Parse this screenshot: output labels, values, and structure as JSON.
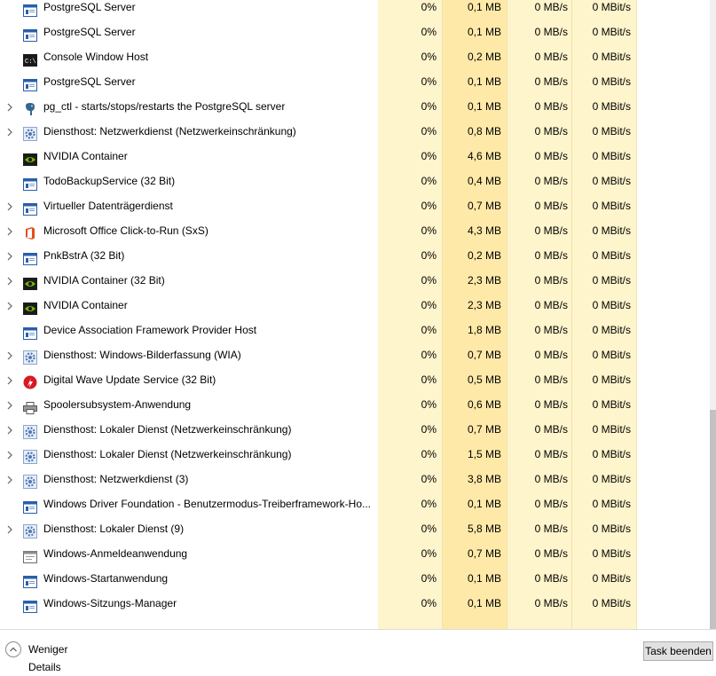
{
  "processes": [
    {
      "name": "PostgreSQL Server",
      "icon": "service-window-icon",
      "expandable": false,
      "cpu": "0%",
      "mem": "0,1 MB",
      "disk": "0 MB/s",
      "net": "0 MBit/s"
    },
    {
      "name": "PostgreSQL Server",
      "icon": "service-window-icon",
      "expandable": false,
      "cpu": "0%",
      "mem": "0,1 MB",
      "disk": "0 MB/s",
      "net": "0 MBit/s"
    },
    {
      "name": "Console Window Host",
      "icon": "console-icon",
      "expandable": false,
      "cpu": "0%",
      "mem": "0,2 MB",
      "disk": "0 MB/s",
      "net": "0 MBit/s"
    },
    {
      "name": "PostgreSQL Server",
      "icon": "service-window-icon",
      "expandable": false,
      "cpu": "0%",
      "mem": "0,1 MB",
      "disk": "0 MB/s",
      "net": "0 MBit/s"
    },
    {
      "name": "pg_ctl - starts/stops/restarts the PostgreSQL server",
      "icon": "postgres-elephant-icon",
      "expandable": true,
      "cpu": "0%",
      "mem": "0,1 MB",
      "disk": "0 MB/s",
      "net": "0 MBit/s"
    },
    {
      "name": "Diensthost: Netzwerkdienst (Netzwerkeinschränkung)",
      "icon": "gear-icon",
      "expandable": true,
      "cpu": "0%",
      "mem": "0,8 MB",
      "disk": "0 MB/s",
      "net": "0 MBit/s"
    },
    {
      "name": "NVIDIA Container",
      "icon": "nvidia-icon",
      "expandable": false,
      "cpu": "0%",
      "mem": "4,6 MB",
      "disk": "0 MB/s",
      "net": "0 MBit/s"
    },
    {
      "name": "TodoBackupService (32 Bit)",
      "icon": "service-window-icon",
      "expandable": false,
      "cpu": "0%",
      "mem": "0,4 MB",
      "disk": "0 MB/s",
      "net": "0 MBit/s"
    },
    {
      "name": "Virtueller Datenträgerdienst",
      "icon": "service-window-icon",
      "expandable": true,
      "cpu": "0%",
      "mem": "0,7 MB",
      "disk": "0 MB/s",
      "net": "0 MBit/s"
    },
    {
      "name": "Microsoft Office Click-to-Run (SxS)",
      "icon": "office-icon",
      "expandable": true,
      "cpu": "0%",
      "mem": "4,3 MB",
      "disk": "0 MB/s",
      "net": "0 MBit/s"
    },
    {
      "name": "PnkBstrA (32 Bit)",
      "icon": "service-window-icon",
      "expandable": true,
      "cpu": "0%",
      "mem": "0,2 MB",
      "disk": "0 MB/s",
      "net": "0 MBit/s"
    },
    {
      "name": "NVIDIA Container (32 Bit)",
      "icon": "nvidia-icon",
      "expandable": true,
      "cpu": "0%",
      "mem": "2,3 MB",
      "disk": "0 MB/s",
      "net": "0 MBit/s"
    },
    {
      "name": "NVIDIA Container",
      "icon": "nvidia-icon",
      "expandable": true,
      "cpu": "0%",
      "mem": "2,3 MB",
      "disk": "0 MB/s",
      "net": "0 MBit/s"
    },
    {
      "name": "Device Association Framework Provider Host",
      "icon": "service-window-icon",
      "expandable": false,
      "cpu": "0%",
      "mem": "1,8 MB",
      "disk": "0 MB/s",
      "net": "0 MBit/s"
    },
    {
      "name": "Diensthost: Windows-Bilderfassung (WIA)",
      "icon": "gear-icon",
      "expandable": true,
      "cpu": "0%",
      "mem": "0,7 MB",
      "disk": "0 MB/s",
      "net": "0 MBit/s"
    },
    {
      "name": "Digital Wave Update Service (32 Bit)",
      "icon": "digital-wave-icon",
      "expandable": true,
      "cpu": "0%",
      "mem": "0,5 MB",
      "disk": "0 MB/s",
      "net": "0 MBit/s"
    },
    {
      "name": "Spoolersubsystem-Anwendung",
      "icon": "printer-icon",
      "expandable": true,
      "cpu": "0%",
      "mem": "0,6 MB",
      "disk": "0 MB/s",
      "net": "0 MBit/s"
    },
    {
      "name": "Diensthost: Lokaler Dienst (Netzwerkeinschränkung)",
      "icon": "gear-icon",
      "expandable": true,
      "cpu": "0%",
      "mem": "0,7 MB",
      "disk": "0 MB/s",
      "net": "0 MBit/s"
    },
    {
      "name": "Diensthost: Lokaler Dienst (Netzwerkeinschränkung)",
      "icon": "gear-icon",
      "expandable": true,
      "cpu": "0%",
      "mem": "1,5 MB",
      "disk": "0 MB/s",
      "net": "0 MBit/s"
    },
    {
      "name": "Diensthost: Netzwerkdienst (3)",
      "icon": "gear-icon",
      "expandable": true,
      "cpu": "0%",
      "mem": "3,8 MB",
      "disk": "0 MB/s",
      "net": "0 MBit/s"
    },
    {
      "name": "Windows Driver Foundation - Benutzermodus-Treiberframework-Ho...",
      "icon": "service-window-icon",
      "expandable": false,
      "cpu": "0%",
      "mem": "0,1 MB",
      "disk": "0 MB/s",
      "net": "0 MBit/s"
    },
    {
      "name": "Diensthost: Lokaler Dienst (9)",
      "icon": "gear-icon",
      "expandable": true,
      "cpu": "0%",
      "mem": "5,8 MB",
      "disk": "0 MB/s",
      "net": "0 MBit/s"
    },
    {
      "name": "Windows-Anmeldeanwendung",
      "icon": "window-app-icon",
      "expandable": false,
      "cpu": "0%",
      "mem": "0,7 MB",
      "disk": "0 MB/s",
      "net": "0 MBit/s"
    },
    {
      "name": "Windows-Startanwendung",
      "icon": "service-window-icon",
      "expandable": false,
      "cpu": "0%",
      "mem": "0,1 MB",
      "disk": "0 MB/s",
      "net": "0 MBit/s"
    },
    {
      "name": "Windows-Sitzungs-Manager",
      "icon": "service-window-icon",
      "expandable": false,
      "cpu": "0%",
      "mem": "0,1 MB",
      "disk": "0 MB/s",
      "net": "0 MBit/s"
    }
  ],
  "footer": {
    "fewer_details_label": "Weniger Details",
    "end_task_label": "Task beenden"
  },
  "colors": {
    "cpu_band": "#fff5cc",
    "memory_band": "#ffe9a8",
    "accent": "#1e6fbf"
  }
}
